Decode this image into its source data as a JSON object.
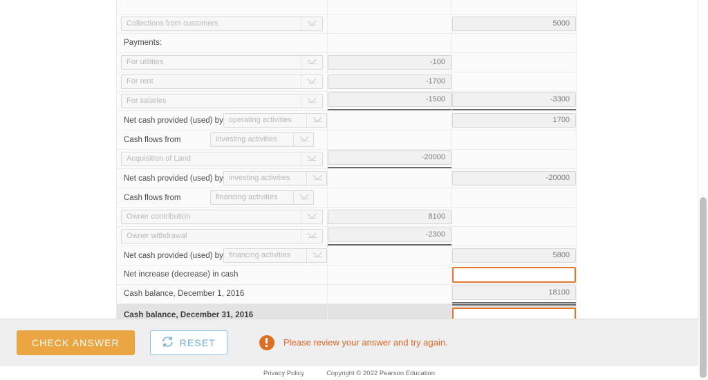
{
  "worksheet": {
    "rows": [
      {
        "id": "row-cut-top",
        "type": "partial",
        "label": "",
        "select_value": "",
        "mid_value": "",
        "right_value": ""
      },
      {
        "id": "row-collections",
        "type": "select-left",
        "select_value": "Collections from customers",
        "mid_value": "",
        "right_value": "5000"
      },
      {
        "id": "row-payments-heading",
        "type": "text-left",
        "label": "Payments:",
        "mid_value": "",
        "right_value": ""
      },
      {
        "id": "row-for-utilities",
        "type": "select-left",
        "select_value": "For utilities",
        "mid_value": "-100",
        "right_value": ""
      },
      {
        "id": "row-for-rent",
        "type": "select-left",
        "select_value": "For rent",
        "mid_value": "-1700",
        "right_value": ""
      },
      {
        "id": "row-for-salaries",
        "type": "select-left",
        "select_value": "For salaries",
        "mid_value": "-1500",
        "mid_underline": "single",
        "right_value": "-3300",
        "right_underline": "single"
      },
      {
        "id": "row-net-operating",
        "type": "split",
        "label": "Net cash provided (used) by",
        "select_value": "operating activities",
        "mid_value": "",
        "right_value": "1700"
      },
      {
        "id": "row-cashflows-investing",
        "type": "split",
        "label": "Cash flows from",
        "select_value": "investing activities",
        "mid_value": "",
        "right_value": ""
      },
      {
        "id": "row-acquisition-land",
        "type": "select-left",
        "select_value": "Acquisition of Land",
        "mid_value": "-20000",
        "mid_underline": "single",
        "right_value": ""
      },
      {
        "id": "row-net-investing",
        "type": "split",
        "label": "Net cash provided (used) by",
        "select_value": "investing activities",
        "mid_value": "",
        "right_value": "-20000"
      },
      {
        "id": "row-cashflows-financing",
        "type": "split",
        "label": "Cash flows from",
        "select_value": "financing activities",
        "mid_value": "",
        "right_value": ""
      },
      {
        "id": "row-owner-contribution",
        "type": "select-left",
        "select_value": "Owner contribution",
        "mid_value": "8100",
        "right_value": ""
      },
      {
        "id": "row-owner-withdrawal",
        "type": "select-left",
        "select_value": "Owner withdrawal",
        "mid_value": "-2300",
        "mid_underline": "single",
        "right_value": ""
      },
      {
        "id": "row-net-financing",
        "type": "split",
        "label": "Net cash provided (used) by",
        "select_value": "financing activities",
        "mid_value": "",
        "right_value": "5800"
      },
      {
        "id": "row-net-increase",
        "type": "text-left",
        "label": "Net increase (decrease) in cash",
        "mid_value": "",
        "right_value": "",
        "right_answer": true
      },
      {
        "id": "row-cash-balance-dec1",
        "type": "text-left",
        "label": "Cash balance, December 1, 2016",
        "mid_value": "",
        "right_value": "18100",
        "right_underline": "single"
      },
      {
        "id": "row-cash-balance-dec31",
        "type": "text-left",
        "label": "Cash balance, December 31, 2016",
        "bold": true,
        "shaded": true,
        "mid_value": "",
        "right_value": "",
        "right_answer": true,
        "right_underline": "double",
        "right_overline": true
      }
    ]
  },
  "actionbar": {
    "check_label": "CHECK ANSWER",
    "reset_label": "RESET",
    "reset_icon": "refresh-icon",
    "error_icon": "error-exclamation-icon",
    "error_message": "Please review your answer and try again."
  },
  "footer": {
    "privacy_label": "Privacy Policy",
    "copyright": "Copyright © 2022 Pearson Education"
  },
  "scrollbar": {
    "orientation": "vertical"
  },
  "colors": {
    "accent_orange": "#e2762a",
    "check_button": "#eba542",
    "reset_border": "#8cc3e4",
    "error_text": "#e0662a",
    "shaded_row": "#e3e3e3"
  }
}
